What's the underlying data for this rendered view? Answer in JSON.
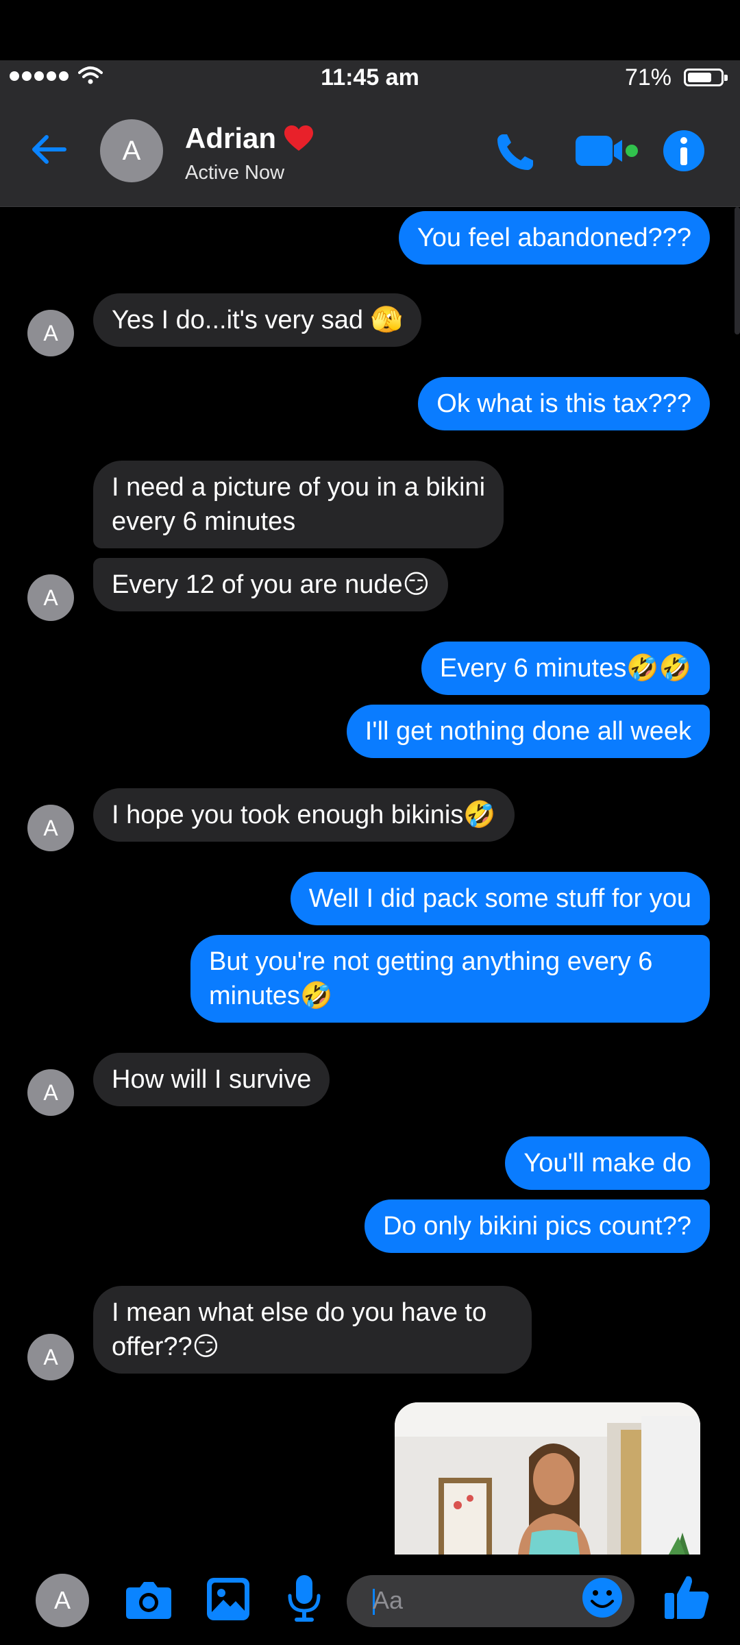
{
  "status_bar": {
    "time": "11:45 am",
    "battery_pct": "71%"
  },
  "header": {
    "avatar_initial": "A",
    "contact_name": "Adrian",
    "status": "Active Now"
  },
  "messages": [
    {
      "from": "me",
      "text": "You feel abandoned???"
    },
    {
      "from": "them",
      "text": "Yes I do...it's very sad 🫣"
    },
    {
      "from": "me",
      "text": "Ok what is this tax???"
    },
    {
      "from": "them",
      "text": "I need a picture of you in a bikini\nevery 6 minutes"
    },
    {
      "from": "them",
      "text": "Every 12 of you are nude😏"
    },
    {
      "from": "me",
      "text": "Every 6 minutes🤣🤣"
    },
    {
      "from": "me",
      "text": "I'll get nothing done all week"
    },
    {
      "from": "them",
      "text": "I hope you took enough bikinis🤣"
    },
    {
      "from": "me",
      "text": "Well I did pack some stuff for you"
    },
    {
      "from": "me",
      "text": "But you're not getting anything every 6\nminutes🤣"
    },
    {
      "from": "them",
      "text": "How will I survive"
    },
    {
      "from": "me",
      "text": "You'll make do"
    },
    {
      "from": "me",
      "text": "Do only bikini pics count??"
    },
    {
      "from": "them",
      "text": "I mean what else do you have to\noffer??😏"
    }
  ],
  "avatar_initial": "A",
  "composer": {
    "avatar_initial": "A",
    "placeholder": "Aa"
  },
  "icons": {
    "back": "arrow-left-icon",
    "call": "phone-icon",
    "video": "video-camera-icon",
    "info": "info-icon",
    "camera": "camera-icon",
    "gallery": "image-icon",
    "mic": "microphone-icon",
    "emoji": "smiley-icon",
    "like": "thumbs-up-icon"
  },
  "colors": {
    "accent": "#0a7cff",
    "sent_bubble": "#0a7cff",
    "received_bubble": "#262628",
    "online": "#31c24d",
    "heart": "#e8212a"
  }
}
